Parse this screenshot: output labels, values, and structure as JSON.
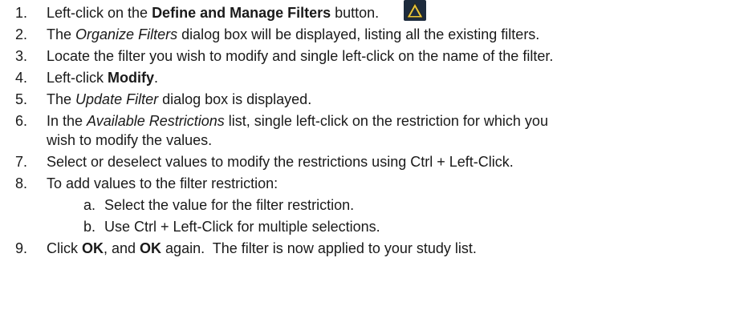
{
  "steps": [
    {
      "number": "1.",
      "pre": "Left-click on the ",
      "bold": "Define and Manage Filters",
      "post": " button.",
      "icon": "define-and-manage-filters-icon"
    },
    {
      "number": "2.",
      "pre": "The ",
      "italic": "Organize Filters",
      "post": " dialog box will be displayed, listing all the existing filters."
    },
    {
      "number": "3.",
      "text": "Locate the filter you wish to modify and single left-click on the name of the filter."
    },
    {
      "number": "4.",
      "pre": "Left-click ",
      "bold": "Modify",
      "post": "."
    },
    {
      "number": "5.",
      "pre": "The ",
      "italic": "Update Filter",
      "post": " dialog box is displayed."
    },
    {
      "number": "6.",
      "pre": "In the ",
      "italic": "Available Restrictions",
      "post": " list, single left-click on the restriction for which you",
      "continuation": "wish to modify the values."
    },
    {
      "number": "7.",
      "text": "Select or deselect values to modify the restrictions using Ctrl + Left-Click."
    },
    {
      "number": "8.",
      "text": "To add values to the filter restriction:",
      "substeps": [
        {
          "letter": "a.",
          "text": "Select the value for the filter restriction."
        },
        {
          "letter": "b.",
          "text": "Use Ctrl + Left-Click for multiple selections."
        }
      ]
    },
    {
      "number": "9.",
      "pre": "Click ",
      "bold": "OK",
      "mid": ", and ",
      "bold2": "OK",
      "post": " again.  The filter is now applied to your study list."
    }
  ],
  "colors": {
    "text": "#1a1a1a",
    "icon_background": "#1d2b3d",
    "icon_triangle": "#e9c53a"
  }
}
